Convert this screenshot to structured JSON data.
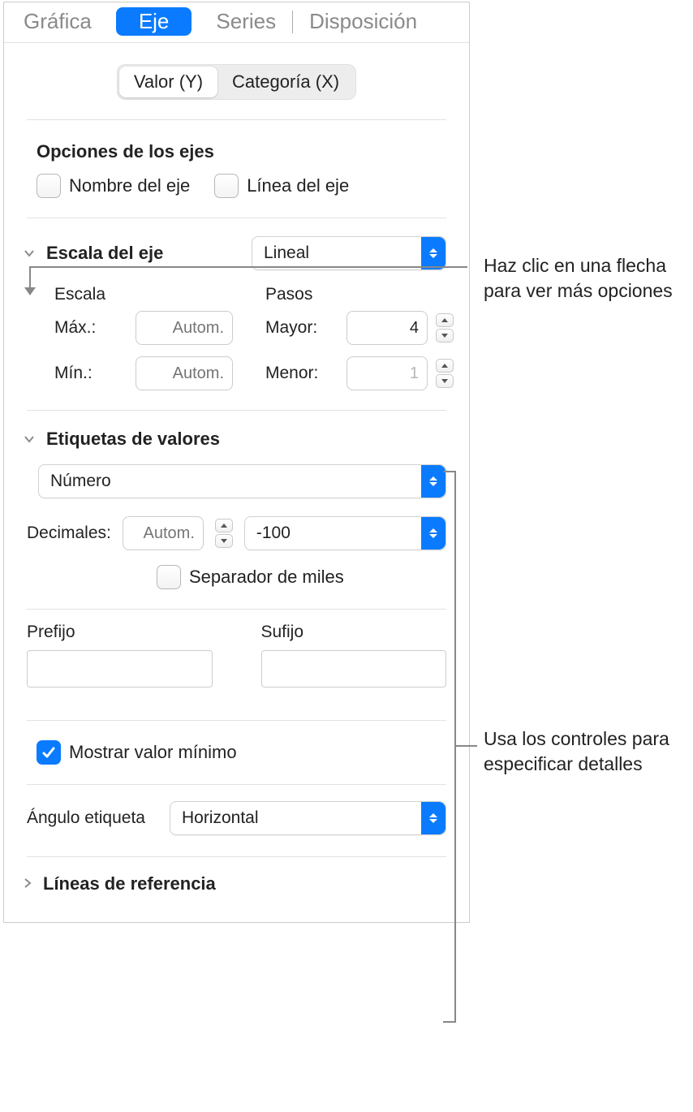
{
  "tabs": {
    "chart": "Gráfica",
    "axis": "Eje",
    "series": "Series",
    "layout": "Disposición"
  },
  "segmented": {
    "valueY": "Valor (Y)",
    "categoryX": "Categoría (X)"
  },
  "axisOptions": {
    "title": "Opciones de los ejes",
    "axisName": "Nombre del eje",
    "axisLine": "Línea del eje"
  },
  "axisScale": {
    "title": "Escala del eje",
    "scaleType": "Lineal",
    "scaleHead": "Escala",
    "stepsHead": "Pasos",
    "maxLabel": "Máx.:",
    "maxPlaceholder": "Autom.",
    "minLabel": "Mín.:",
    "minPlaceholder": "Autom.",
    "majorLabel": "Mayor:",
    "majorValue": "4",
    "minorLabel": "Menor:",
    "minorValue": "1"
  },
  "valueLabels": {
    "title": "Etiquetas de valores",
    "format": "Número",
    "decimalsLabel": "Decimales:",
    "decimalsPlaceholder": "Autom.",
    "negative": "-100",
    "thousands": "Separador de miles",
    "prefixLabel": "Prefijo",
    "suffixLabel": "Sufijo",
    "showMin": "Mostrar valor mínimo",
    "angleLabel": "Ángulo etiqueta",
    "angleValue": "Horizontal"
  },
  "refLines": {
    "title": "Líneas de referencia"
  },
  "callouts": {
    "top": "Haz clic en una flecha para ver más opciones",
    "mid": "Usa los controles para especificar detalles"
  }
}
